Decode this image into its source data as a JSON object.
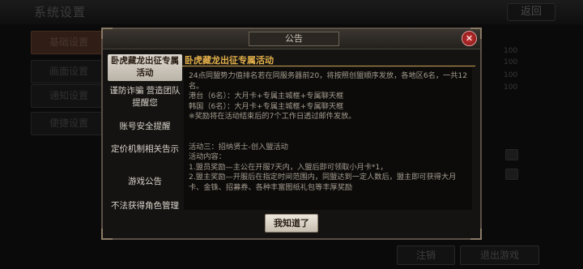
{
  "background": {
    "title": "系统设置",
    "back_label": "返回",
    "side_menu": [
      {
        "label": "基础设置",
        "active": true
      },
      {
        "label": "画面设置",
        "active": false
      },
      {
        "label": "通知设置",
        "active": false
      },
      {
        "label": "便捷设置",
        "active": false
      }
    ],
    "values": [
      "100",
      "100",
      "100",
      "100"
    ],
    "bottom_buttons": {
      "logout": "注销",
      "exit": "退出游戏"
    }
  },
  "dialog": {
    "title": "公告",
    "close_icon": "close-icon",
    "tabs": [
      {
        "label": "卧虎藏龙出征专属活动",
        "active": true
      },
      {
        "label": "谨防诈骗 营造团队提醒您",
        "active": false
      },
      {
        "label": "账号安全提醒",
        "active": false
      },
      {
        "label": "定价机制相关告示",
        "active": false
      },
      {
        "label": "游戏公告",
        "active": false
      },
      {
        "label": "不法获得角色管理",
        "active": false
      }
    ],
    "content_title": "卧虎藏龙出征专属活动",
    "content_lines": [
      "24点同盟势力值排名若在同服务器前20，将按照创盟顺序发放，各地区6名，一共12名。",
      "港台（6名）：大月卡+专属主城框+专属聊天框",
      "韩国（6名）：大月卡+专属主城框+专属聊天框",
      "※奖励将在活动结束后的7个工作日透过邮件发放。",
      "",
      "",
      "活动三：招纳贤士-创入盟活动",
      "活动内容：",
      "1.盟员奖励—主公在开服7天内，入盟后即可领取小月卡*1，",
      "2.盟主奖励—开服后在指定时间范围内，同盟达到一定人数后，盟主即可获得大月卡、金铢、招募券、各种丰富图纸礼包等丰厚奖励"
    ],
    "ok_label": "我知道了"
  }
}
